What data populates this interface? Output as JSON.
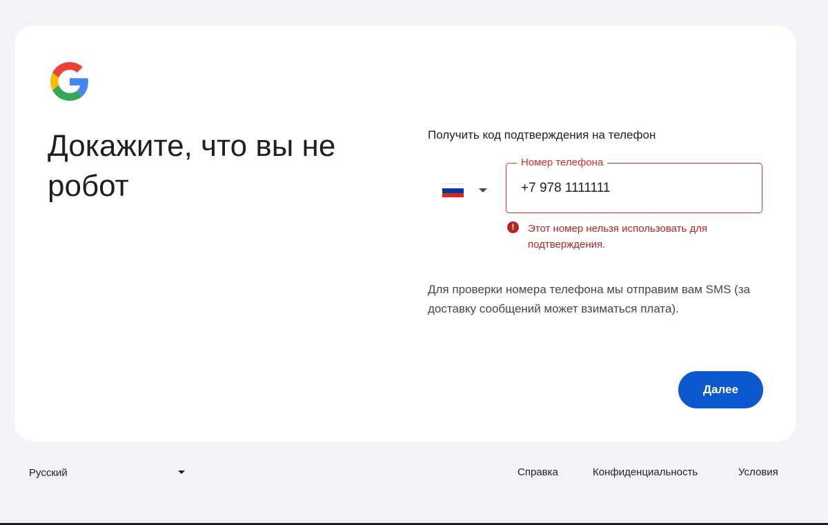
{
  "page": {
    "title_line1": "Докажите, что вы не",
    "title_line2": "робот"
  },
  "logo": {
    "name": "google-logo",
    "colors": {
      "blue": "#4285f4",
      "red": "#ea4335",
      "yellow": "#fbbc05",
      "green": "#34a853"
    }
  },
  "form": {
    "subtitle": "Получить код подтверждения на телефон",
    "country": {
      "icon": "russia-flag-icon",
      "flag_colors": [
        "#ffffff",
        "#0039a6",
        "#d52b1e"
      ]
    },
    "phone": {
      "label": "Номер телефона",
      "value": "+7 978 1111111"
    },
    "error": {
      "icon": "error-icon",
      "icon_glyph": "!",
      "message": "Этот номер нельзя использовать для подтверждения."
    },
    "info": "Для проверки номера телефона мы отправим вам SMS (за доставку сообщений может взиматься плата).",
    "next_button": "Далее"
  },
  "footer": {
    "language": "Русский",
    "links": {
      "help": "Справка",
      "privacy": "Конфиденциальность",
      "terms": "Условия"
    }
  },
  "colors": {
    "accent": "#0b57d0",
    "error": "#b3261e",
    "background": "#f0f4f9",
    "card": "#ffffff"
  }
}
